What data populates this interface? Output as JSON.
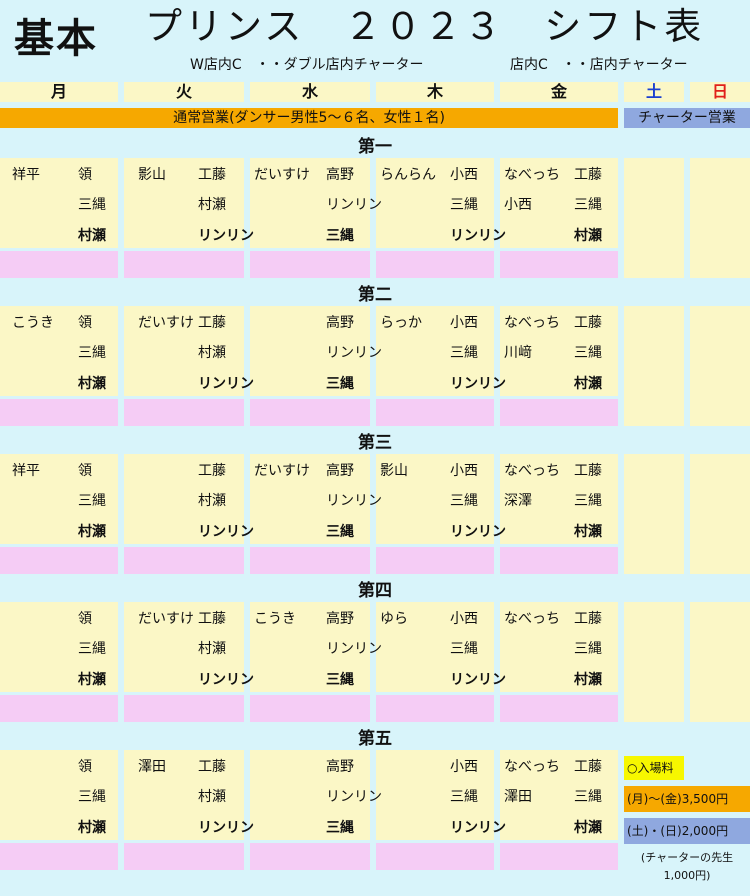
{
  "header": {
    "kihon": "基本",
    "title": "プリンス　２０２３　シフト表",
    "note_w": "W店内C　・・ダブル店内チャーター",
    "note_c": "店内C　・・店内チャーター"
  },
  "days": [
    "月",
    "火",
    "水",
    "木",
    "金",
    "土",
    "日"
  ],
  "bands": {
    "regular": "通常営業(ダンサー男性5～６名、女性１名)",
    "charter": "チャーター営業"
  },
  "weeks": [
    {
      "label": "第一",
      "rows": [
        [
          "祥平",
          "領",
          "影山",
          "工藤",
          "だいすけ",
          "高野",
          "らんらん",
          "小西",
          "なべっち",
          "工藤"
        ],
        [
          "",
          "三縄",
          "",
          "村瀬",
          "",
          "リンリン",
          "",
          "三縄",
          "小西",
          "三縄"
        ],
        [
          "",
          "村瀬",
          "",
          "リンリン",
          "",
          "三縄",
          "",
          "リンリン",
          "",
          "村瀬"
        ]
      ]
    },
    {
      "label": "第二",
      "rows": [
        [
          "こうき",
          "領",
          "だいすけ",
          "工藤",
          "",
          "高野",
          "らっか",
          "小西",
          "なべっち",
          "工藤"
        ],
        [
          "",
          "三縄",
          "",
          "村瀬",
          "",
          "リンリン",
          "",
          "三縄",
          "川﨑",
          "三縄"
        ],
        [
          "",
          "村瀬",
          "",
          "リンリン",
          "",
          "三縄",
          "",
          "リンリン",
          "",
          "村瀬"
        ]
      ]
    },
    {
      "label": "第三",
      "rows": [
        [
          "祥平",
          "領",
          "",
          "工藤",
          "だいすけ",
          "高野",
          "影山",
          "小西",
          "なべっち",
          "工藤"
        ],
        [
          "",
          "三縄",
          "",
          "村瀬",
          "",
          "リンリン",
          "",
          "三縄",
          "深澤",
          "三縄"
        ],
        [
          "",
          "村瀬",
          "",
          "リンリン",
          "",
          "三縄",
          "",
          "リンリン",
          "",
          "村瀬"
        ]
      ]
    },
    {
      "label": "第四",
      "rows": [
        [
          "",
          "領",
          "だいすけ",
          "工藤",
          "こうき",
          "高野",
          "ゆら",
          "小西",
          "なべっち",
          "工藤"
        ],
        [
          "",
          "三縄",
          "",
          "村瀬",
          "",
          "リンリン",
          "",
          "三縄",
          "",
          "三縄"
        ],
        [
          "",
          "村瀬",
          "",
          "リンリン",
          "",
          "三縄",
          "",
          "リンリン",
          "",
          "村瀬"
        ]
      ]
    },
    {
      "label": "第五",
      "rows": [
        [
          "",
          "領",
          "澤田",
          "工藤",
          "",
          "高野",
          "",
          "小西",
          "なべっち",
          "工藤"
        ],
        [
          "",
          "三縄",
          "",
          "村瀬",
          "",
          "リンリン",
          "",
          "三縄",
          "澤田",
          "三縄"
        ],
        [
          "",
          "村瀬",
          "",
          "リンリン",
          "",
          "三縄",
          "",
          "リンリン",
          "",
          "村瀬"
        ]
      ]
    }
  ],
  "fees": {
    "title": "○入場料",
    "weekday": "(月)～(金)3,500円",
    "weekend": "(土)・(日)2,000円",
    "note_line1": "(チャーターの先生",
    "note_line2": "1,000円)"
  },
  "colors": {
    "background": "#d8f4fa",
    "cell": "#fbf7c6",
    "pink_row": "#f5ccf5",
    "regular_band": "#f6a800",
    "charter_band": "#8fa8df",
    "saturday": "#1a3fd0",
    "sunday": "#e0201a"
  }
}
